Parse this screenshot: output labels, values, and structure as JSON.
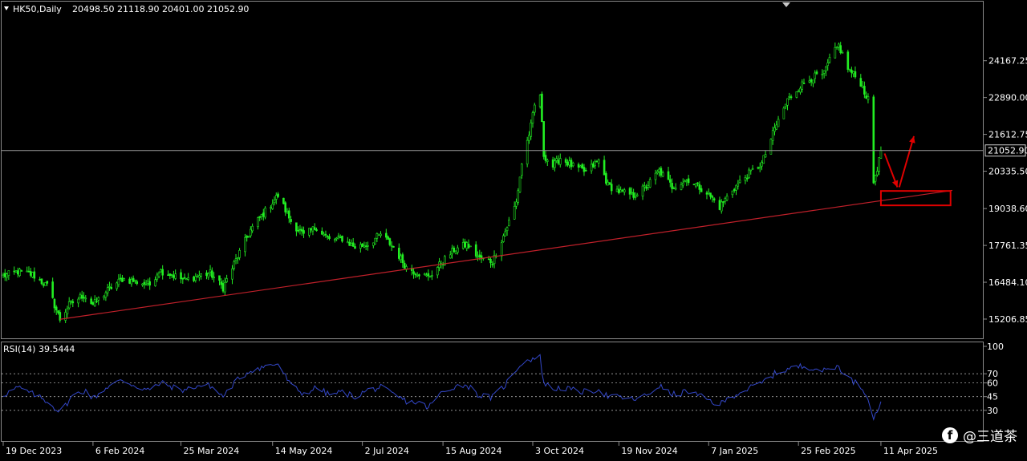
{
  "chart_data": [
    {
      "type": "candlestick",
      "symbol_label": "HK50,Daily",
      "ohlc_label": "20498.50 21118.90 20401.00 21052.90",
      "last_price": 21052.9,
      "last_price_label": "21052.90",
      "y_ticks": [
        24167.25,
        22890.0,
        21612.75,
        20335.5,
        19038.6,
        17761.35,
        16484.1,
        15206.85
      ],
      "y_tick_labels": [
        "24167.25",
        "22890.00",
        "21612.75",
        "20335.50",
        "19038.60",
        "17761.35",
        "16484.10",
        "15206.85"
      ],
      "x_tick_labels": [
        "19 Dec 2023",
        "6 Feb 2024",
        "25 Mar 2024",
        "14 May 2024",
        "2 Jul 2024",
        "15 Aug 2024",
        "3 Oct 2024",
        "19 Nov 2024",
        "7 Jan 2025",
        "25 Feb 2025",
        "11 Apr 2025"
      ],
      "x_ticks": [
        "2023-12-19",
        "2024-02-06",
        "2024-03-25",
        "2024-05-14",
        "2024-07-02",
        "2024-08-15",
        "2024-10-03",
        "2024-11-19",
        "2025-01-07",
        "2025-02-25",
        "2025-04-11"
      ],
      "xlim": [
        "2023-12-19",
        "2025-05-20"
      ],
      "ylim": [
        14650,
        26050
      ],
      "close_path": [
        [
          "2023-12-19",
          16700
        ],
        [
          "2023-12-27",
          16850
        ],
        [
          "2024-01-04",
          16750
        ],
        [
          "2024-01-12",
          16350
        ],
        [
          "2024-01-19",
          15200
        ],
        [
          "2024-01-24",
          15700
        ],
        [
          "2024-02-01",
          16050
        ],
        [
          "2024-02-06",
          15700
        ],
        [
          "2024-02-14",
          16200
        ],
        [
          "2024-02-22",
          16600
        ],
        [
          "2024-03-01",
          16500
        ],
        [
          "2024-03-08",
          16400
        ],
        [
          "2024-03-13",
          16900
        ],
        [
          "2024-03-20",
          16750
        ],
        [
          "2024-03-27",
          16550
        ],
        [
          "2024-04-03",
          16700
        ],
        [
          "2024-04-10",
          16800
        ],
        [
          "2024-04-17",
          16300
        ],
        [
          "2024-04-24",
          17250
        ],
        [
          "2024-05-02",
          18300
        ],
        [
          "2024-05-10",
          18950
        ],
        [
          "2024-05-17",
          19500
        ],
        [
          "2024-05-24",
          18600
        ],
        [
          "2024-05-31",
          18100
        ],
        [
          "2024-06-07",
          18400
        ],
        [
          "2024-06-14",
          17950
        ],
        [
          "2024-06-21",
          18000
        ],
        [
          "2024-06-28",
          17700
        ],
        [
          "2024-07-05",
          17800
        ],
        [
          "2024-07-12",
          18150
        ],
        [
          "2024-07-19",
          17700
        ],
        [
          "2024-07-26",
          17000
        ],
        [
          "2024-08-02",
          16800
        ],
        [
          "2024-08-07",
          16650
        ],
        [
          "2024-08-14",
          17150
        ],
        [
          "2024-08-21",
          17600
        ],
        [
          "2024-08-28",
          17800
        ],
        [
          "2024-09-04",
          17300
        ],
        [
          "2024-09-11",
          17200
        ],
        [
          "2024-09-18",
          18250
        ],
        [
          "2024-09-24",
          19250
        ],
        [
          "2024-09-27",
          20600
        ],
        [
          "2024-10-02",
          21900
        ],
        [
          "2024-10-04",
          22600
        ],
        [
          "2024-10-07",
          23000
        ],
        [
          "2024-10-09",
          20900
        ],
        [
          "2024-10-14",
          20500
        ],
        [
          "2024-10-18",
          20800
        ],
        [
          "2024-10-25",
          20500
        ],
        [
          "2024-11-01",
          20300
        ],
        [
          "2024-11-08",
          20700
        ],
        [
          "2024-11-13",
          19850
        ],
        [
          "2024-11-20",
          19600
        ],
        [
          "2024-11-27",
          19500
        ],
        [
          "2024-12-04",
          19800
        ],
        [
          "2024-12-11",
          20350
        ],
        [
          "2024-12-18",
          19800
        ],
        [
          "2024-12-27",
          20050
        ],
        [
          "2025-01-06",
          19600
        ],
        [
          "2025-01-13",
          19100
        ],
        [
          "2025-01-20",
          19700
        ],
        [
          "2025-01-28",
          20200
        ],
        [
          "2025-02-05",
          20600
        ],
        [
          "2025-02-12",
          21800
        ],
        [
          "2025-02-19",
          22800
        ],
        [
          "2025-02-26",
          23300
        ],
        [
          "2025-03-05",
          23600
        ],
        [
          "2025-03-11",
          23700
        ],
        [
          "2025-03-14",
          24200
        ],
        [
          "2025-03-19",
          24700
        ],
        [
          "2025-03-24",
          23900
        ],
        [
          "2025-03-31",
          23400
        ],
        [
          "2025-04-04",
          22800
        ],
        [
          "2025-04-07",
          19950
        ],
        [
          "2025-04-08",
          20200
        ],
        [
          "2025-04-10",
          20700
        ],
        [
          "2025-04-11",
          21052.9
        ]
      ],
      "trendline": [
        [
          "2024-01-19",
          15200
        ],
        [
          "2025-05-20",
          19670
        ]
      ],
      "annotation_box": {
        "x": [
          "2025-04-11",
          "2025-05-19"
        ],
        "y": [
          19150,
          19650
        ],
        "color": "#e00000"
      },
      "arrows": [
        {
          "from": [
            "2025-04-13",
            20950
          ],
          "to": [
            "2025-04-20",
            19780
          ],
          "color": "#e00000"
        },
        {
          "from": [
            "2025-04-21",
            19780
          ],
          "to": [
            "2025-04-29",
            21550
          ],
          "color": "#e00000"
        }
      ],
      "colors": {
        "candle": "#22ee22",
        "trendline": "#c0202a",
        "price_line": "#9a9a9a"
      }
    },
    {
      "type": "line",
      "label": "RSI(14) 39.5444",
      "series": [
        {
          "name": "RSI(14)",
          "color": "#3347c8",
          "values": [
            [
              "2023-12-19",
              47
            ],
            [
              "2023-12-27",
              55
            ],
            [
              "2024-01-05",
              47
            ],
            [
              "2024-01-12",
              40
            ],
            [
              "2024-01-19",
              28
            ],
            [
              "2024-01-26",
              46
            ],
            [
              "2024-02-02",
              52
            ],
            [
              "2024-02-06",
              43
            ],
            [
              "2024-02-14",
              56
            ],
            [
              "2024-02-22",
              63
            ],
            [
              "2024-03-01",
              56
            ],
            [
              "2024-03-08",
              52
            ],
            [
              "2024-03-14",
              60
            ],
            [
              "2024-03-21",
              55
            ],
            [
              "2024-03-27",
              52
            ],
            [
              "2024-04-03",
              57
            ],
            [
              "2024-04-10",
              57
            ],
            [
              "2024-04-17",
              45
            ],
            [
              "2024-04-24",
              62
            ],
            [
              "2024-05-02",
              74
            ],
            [
              "2024-05-10",
              78
            ],
            [
              "2024-05-17",
              81
            ],
            [
              "2024-05-24",
              57
            ],
            [
              "2024-05-31",
              48
            ],
            [
              "2024-06-07",
              55
            ],
            [
              "2024-06-14",
              47
            ],
            [
              "2024-06-21",
              50
            ],
            [
              "2024-06-28",
              45
            ],
            [
              "2024-07-05",
              52
            ],
            [
              "2024-07-12",
              55
            ],
            [
              "2024-07-19",
              47
            ],
            [
              "2024-07-26",
              40
            ],
            [
              "2024-08-02",
              38
            ],
            [
              "2024-08-07",
              33
            ],
            [
              "2024-08-14",
              49
            ],
            [
              "2024-08-21",
              56
            ],
            [
              "2024-08-28",
              58
            ],
            [
              "2024-09-04",
              46
            ],
            [
              "2024-09-11",
              44
            ],
            [
              "2024-09-18",
              58
            ],
            [
              "2024-09-24",
              75
            ],
            [
              "2024-09-27",
              82
            ],
            [
              "2024-10-02",
              86
            ],
            [
              "2024-10-04",
              87
            ],
            [
              "2024-10-07",
              88
            ],
            [
              "2024-10-09",
              60
            ],
            [
              "2024-10-14",
              53
            ],
            [
              "2024-10-18",
              55
            ],
            [
              "2024-10-25",
              52
            ],
            [
              "2024-11-01",
              50
            ],
            [
              "2024-11-08",
              53
            ],
            [
              "2024-11-13",
              45
            ],
            [
              "2024-11-20",
              44
            ],
            [
              "2024-11-27",
              42
            ],
            [
              "2024-12-04",
              46
            ],
            [
              "2024-12-11",
              57
            ],
            [
              "2024-12-18",
              47
            ],
            [
              "2024-12-27",
              51
            ],
            [
              "2025-01-06",
              42
            ],
            [
              "2025-01-13",
              36
            ],
            [
              "2025-01-20",
              46
            ],
            [
              "2025-01-28",
              53
            ],
            [
              "2025-02-05",
              60
            ],
            [
              "2025-02-12",
              70
            ],
            [
              "2025-02-19",
              75
            ],
            [
              "2025-02-26",
              78
            ],
            [
              "2025-03-05",
              77
            ],
            [
              "2025-03-11",
              73
            ],
            [
              "2025-03-14",
              76
            ],
            [
              "2025-03-19",
              78
            ],
            [
              "2025-03-24",
              66
            ],
            [
              "2025-03-31",
              56
            ],
            [
              "2025-04-04",
              45
            ],
            [
              "2025-04-07",
              22
            ],
            [
              "2025-04-08",
              25
            ],
            [
              "2025-04-10",
              34
            ],
            [
              "2025-04-11",
              39.5444
            ]
          ]
        }
      ],
      "levels": [
        30,
        45,
        60,
        70
      ],
      "y_tick_labels": [
        "100",
        "70",
        "60",
        "45",
        "30"
      ],
      "y_ticks": [
        100,
        70,
        60,
        45,
        30
      ],
      "ylim": [
        0,
        100
      ]
    }
  ],
  "watermark": {
    "icon": "facebook-icon",
    "text": "@三道茶"
  }
}
